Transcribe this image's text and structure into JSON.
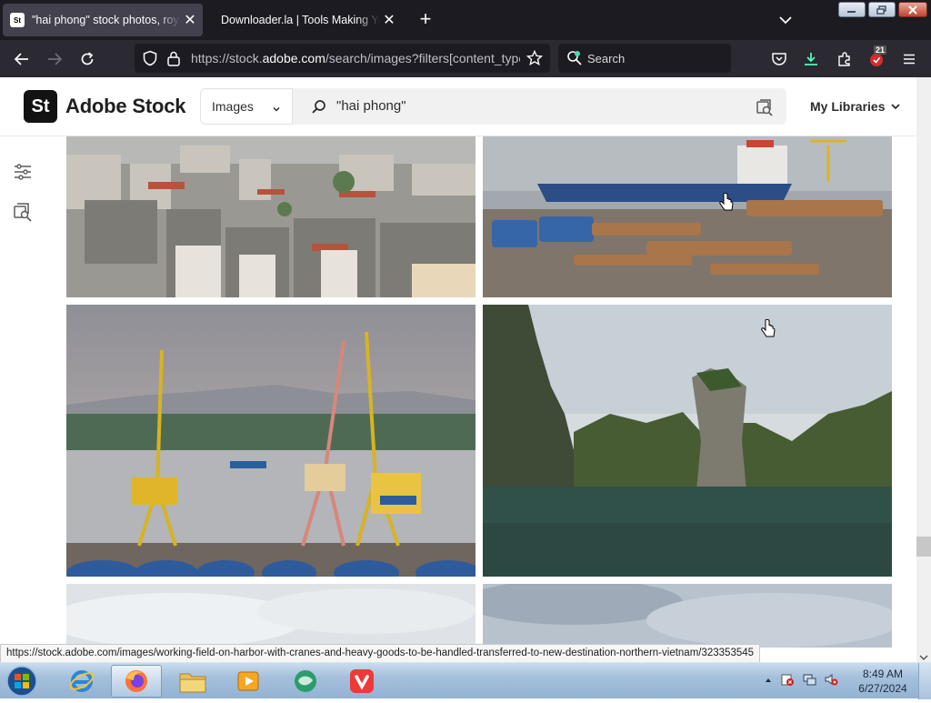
{
  "browser": {
    "tabs": [
      {
        "title": "\"hai phong\" stock photos, royalty",
        "favicon": "St",
        "active": true
      },
      {
        "title": "Downloader.la | Tools Making Your L",
        "active": false
      }
    ],
    "url": {
      "prefix": "https://stock.",
      "domain": "adobe.com",
      "suffix": "/search/images?filters[content_type"
    },
    "search_placeholder": "Search",
    "extension_badge": "21",
    "status_url": "https://stock.adobe.com/images/working-field-on-harbor-with-cranes-and-heavy-goods-to-be-handled-transferred-to-new-destination-northern-vietnam/323353545"
  },
  "site": {
    "logo_text": "St",
    "brand": "Adobe Stock",
    "asset_type": "Images",
    "query": "\"hai phong\"",
    "my_libraries": "My Libraries"
  },
  "results": [
    {
      "id": "city",
      "subject": "dense city rooftops"
    },
    {
      "id": "port",
      "subject": "cargo ship and timber logs at port"
    },
    {
      "id": "cranes",
      "subject": "yellow and pink harbor cranes"
    },
    {
      "id": "bay",
      "subject": "limestone karst in bay"
    },
    {
      "id": "sky-1",
      "subject": "cloudy sky"
    },
    {
      "id": "sky-2",
      "subject": "cloudy sky"
    }
  ],
  "taskbar": {
    "apps": [
      "internet-explorer",
      "firefox",
      "file-explorer",
      "media-player",
      "green-app",
      "vivaldi"
    ],
    "clock_time": "8:49 AM",
    "clock_date": "6/27/2024"
  },
  "colors": {
    "browser_bg": "#1c1b22",
    "toolbar_bg": "#2b2a33",
    "brand_dark": "#121212",
    "vivaldi_red": "#ef3939",
    "download_teal": "#54ffbd"
  }
}
